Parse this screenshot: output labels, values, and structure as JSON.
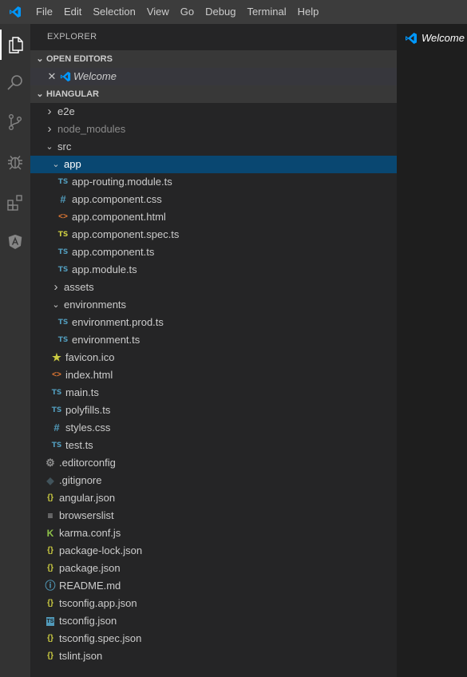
{
  "menubar": {
    "items": [
      "File",
      "Edit",
      "Selection",
      "View",
      "Go",
      "Debug",
      "Terminal",
      "Help"
    ]
  },
  "activity_bar": {
    "icons": [
      "files-icon",
      "search-icon",
      "source-control-icon",
      "debug-icon",
      "extensions-icon",
      "angular-icon"
    ]
  },
  "sidebar": {
    "title": "EXPLORER",
    "open_editors_label": "OPEN EDITORS",
    "open_editors": [
      {
        "label": "Welcome"
      }
    ],
    "project_label": "HIANGULAR",
    "tree": [
      {
        "label": "e2e",
        "type": "folder",
        "expanded": false,
        "depth": 1
      },
      {
        "label": "node_modules",
        "type": "folder",
        "expanded": false,
        "depth": 1,
        "dim": true
      },
      {
        "label": "src",
        "type": "folder",
        "expanded": true,
        "depth": 1
      },
      {
        "label": "app",
        "type": "folder",
        "expanded": true,
        "depth": 2,
        "selected": true
      },
      {
        "label": "app-routing.module.ts",
        "type": "ts",
        "depth": 3
      },
      {
        "label": "app.component.css",
        "type": "css",
        "depth": 3
      },
      {
        "label": "app.component.html",
        "type": "html",
        "depth": 3
      },
      {
        "label": "app.component.spec.ts",
        "type": "spec",
        "depth": 3
      },
      {
        "label": "app.component.ts",
        "type": "ts",
        "depth": 3
      },
      {
        "label": "app.module.ts",
        "type": "ts",
        "depth": 3
      },
      {
        "label": "assets",
        "type": "folder",
        "expanded": false,
        "depth": 2
      },
      {
        "label": "environments",
        "type": "folder",
        "expanded": true,
        "depth": 2
      },
      {
        "label": "environment.prod.ts",
        "type": "ts",
        "depth": 3
      },
      {
        "label": "environment.ts",
        "type": "ts",
        "depth": 3
      },
      {
        "label": "favicon.ico",
        "type": "star",
        "depth": 2
      },
      {
        "label": "index.html",
        "type": "html",
        "depth": 2
      },
      {
        "label": "main.ts",
        "type": "ts",
        "depth": 2
      },
      {
        "label": "polyfills.ts",
        "type": "ts",
        "depth": 2
      },
      {
        "label": "styles.css",
        "type": "css",
        "depth": 2
      },
      {
        "label": "test.ts",
        "type": "ts",
        "depth": 2
      },
      {
        "label": ".editorconfig",
        "type": "gear",
        "depth": 1
      },
      {
        "label": ".gitignore",
        "type": "git",
        "depth": 1
      },
      {
        "label": "angular.json",
        "type": "json",
        "depth": 1
      },
      {
        "label": "browserslist",
        "type": "lines",
        "depth": 1
      },
      {
        "label": "karma.conf.js",
        "type": "karma",
        "depth": 1
      },
      {
        "label": "package-lock.json",
        "type": "json",
        "depth": 1
      },
      {
        "label": "package.json",
        "type": "json",
        "depth": 1
      },
      {
        "label": "README.md",
        "type": "info",
        "depth": 1
      },
      {
        "label": "tsconfig.app.json",
        "type": "json",
        "depth": 1
      },
      {
        "label": "tsconfig.json",
        "type": "tsbox",
        "depth": 1
      },
      {
        "label": "tsconfig.spec.json",
        "type": "json",
        "depth": 1
      },
      {
        "label": "tslint.json",
        "type": "json",
        "depth": 1
      }
    ]
  },
  "editor": {
    "tab_label": "Welcome"
  },
  "colors": {
    "accent": "#007acc",
    "selected": "#094771",
    "ts": "#519aba",
    "json": "#cbcb41",
    "html": "#e37933"
  }
}
